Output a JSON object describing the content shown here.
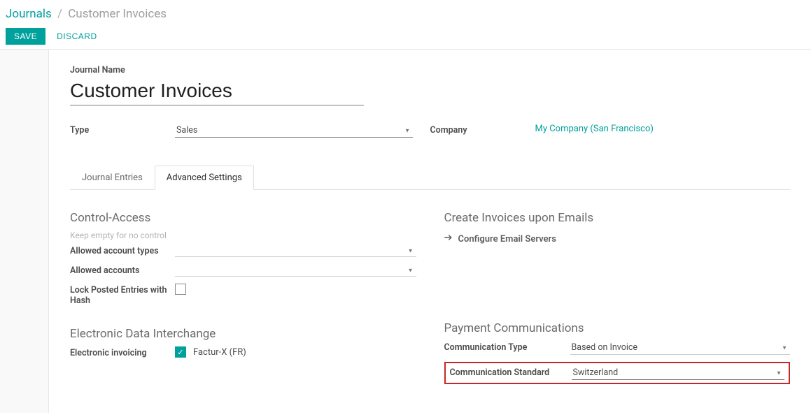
{
  "breadcrumb": {
    "root": "Journals",
    "sep": "/",
    "current": "Customer Invoices"
  },
  "toolbar": {
    "save": "SAVE",
    "discard": "DISCARD"
  },
  "form": {
    "name_label": "Journal Name",
    "name_value": "Customer Invoices",
    "type_label": "Type",
    "type_value": "Sales",
    "company_label": "Company",
    "company_value": "My Company (San Francisco)"
  },
  "tabs": {
    "entries": "Journal Entries",
    "advanced": "Advanced Settings"
  },
  "sections": {
    "control_access": {
      "title": "Control-Access",
      "hint": "Keep empty for no control",
      "allowed_types_label": "Allowed account types",
      "allowed_types_value": "",
      "allowed_accounts_label": "Allowed accounts",
      "allowed_accounts_value": "",
      "lock_label": "Lock Posted Entries with Hash",
      "lock_checked": false
    },
    "edi": {
      "title": "Electronic Data Interchange",
      "einvoice_label": "Electronic invoicing",
      "einvoice_option": "Factur-X (FR)",
      "einvoice_checked": true
    },
    "emails": {
      "title": "Create Invoices upon Emails",
      "configure": "Configure Email Servers"
    },
    "payment": {
      "title": "Payment Communications",
      "comm_type_label": "Communication Type",
      "comm_type_value": "Based on Invoice",
      "comm_std_label": "Communication Standard",
      "comm_std_value": "Switzerland"
    }
  }
}
